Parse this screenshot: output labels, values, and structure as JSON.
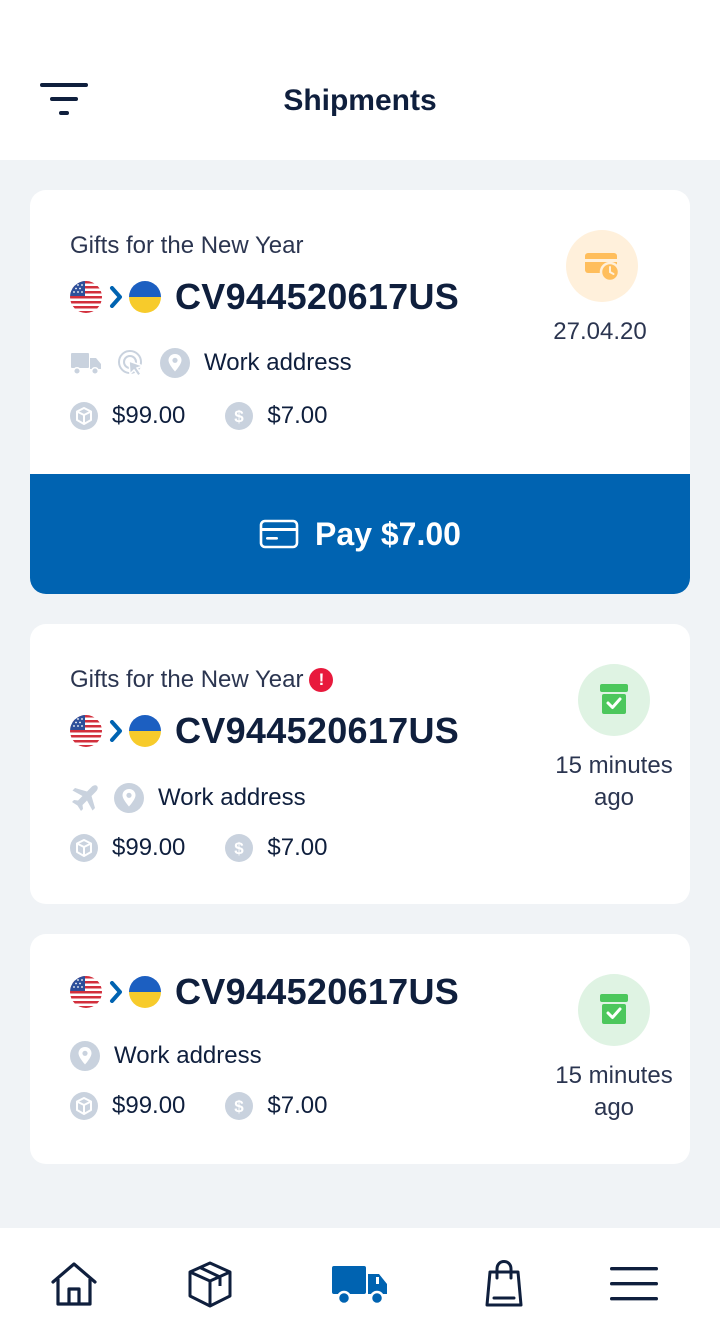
{
  "header": {
    "title": "Shipments",
    "filter_icon": "filter-icon"
  },
  "shipments": [
    {
      "title": "Gifts for the New Year",
      "tracking": "CV944520617US",
      "from_flag": "us-flag-icon",
      "to_flag": "ua-flag-icon",
      "delivery_icons": [
        "truck-icon",
        "pointer-icon",
        "location-pin-icon"
      ],
      "address": "Work address",
      "declared_value": "$99.00",
      "fee": "$7.00",
      "status_icon": "payment-pending-icon",
      "status_text": "27.04.20",
      "pay_button_label": "Pay $7.00"
    },
    {
      "title": "Gifts for the New Year",
      "has_alert": true,
      "alert_symbol": "!",
      "tracking": "CV944520617US",
      "from_flag": "us-flag-icon",
      "to_flag": "ua-flag-icon",
      "delivery_icons": [
        "plane-icon",
        "location-pin-icon"
      ],
      "address": "Work address",
      "declared_value": "$99.00",
      "fee": "$7.00",
      "status_icon": "box-check-icon",
      "status_text": "15 minutes ago"
    },
    {
      "tracking": "CV944520617US",
      "from_flag": "us-flag-icon",
      "to_flag": "ua-flag-icon",
      "delivery_icons": [
        "location-pin-icon"
      ],
      "address": "Work address",
      "declared_value": "$99.00",
      "fee": "$7.00",
      "status_icon": "box-check-icon",
      "status_text": "15 minutes ago"
    }
  ],
  "bottom_nav": [
    {
      "icon": "home-icon",
      "active": false
    },
    {
      "icon": "package-icon",
      "active": false
    },
    {
      "icon": "truck-icon",
      "active": true
    },
    {
      "icon": "shopping-bag-icon",
      "active": false
    },
    {
      "icon": "menu-icon",
      "active": false
    }
  ],
  "colors": {
    "primary": "#0063b1",
    "text_dark": "#0f1f3d",
    "icon_gray": "#c9d2de",
    "background": "#f0f3f6",
    "pending_bg": "#fff0db",
    "pending_icon": "#ffbe5c",
    "success_bg": "#dff3e3",
    "success_icon": "#4cc75c",
    "alert_red": "#e8193c"
  }
}
